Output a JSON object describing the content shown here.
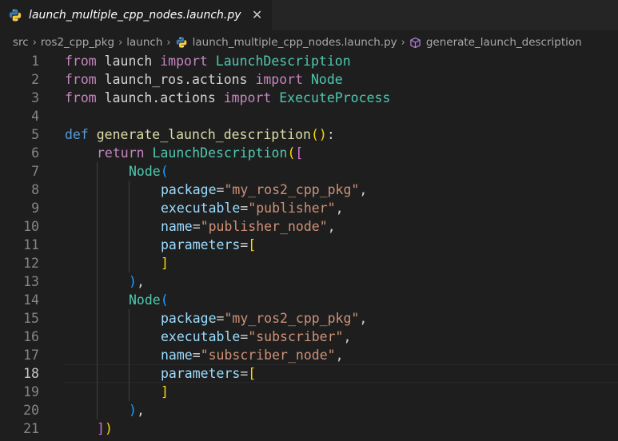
{
  "tab": {
    "label": "launch_multiple_cpp_nodes.launch.py",
    "close_glyph": "✕"
  },
  "breadcrumb": [
    {
      "label": "src",
      "icon": ""
    },
    {
      "label": "ros2_cpp_pkg",
      "icon": ""
    },
    {
      "label": "launch",
      "icon": ""
    },
    {
      "label": "launch_multiple_cpp_nodes.launch.py",
      "icon": "python-icon"
    },
    {
      "label": "generate_launch_description",
      "icon": "cube-icon"
    }
  ],
  "editor": {
    "current_line": 18,
    "colors": {
      "keyword_control": "#c586c0",
      "keyword": "#569cd6",
      "function": "#dcdcaa",
      "class": "#4ec9b0",
      "string": "#ce9178",
      "parameter": "#9cdcfe"
    },
    "lines": [
      {
        "n": "1",
        "indent": 0,
        "t": [
          [
            "from",
            "kw"
          ],
          [
            " launch ",
            "pl"
          ],
          [
            "import",
            "kw"
          ],
          [
            " ",
            "pl"
          ],
          [
            "LaunchDescription",
            "cls"
          ]
        ]
      },
      {
        "n": "2",
        "indent": 0,
        "t": [
          [
            "from",
            "kw"
          ],
          [
            " launch_ros.actions ",
            "pl"
          ],
          [
            "import",
            "kw"
          ],
          [
            " ",
            "pl"
          ],
          [
            "Node",
            "cls"
          ]
        ]
      },
      {
        "n": "3",
        "indent": 0,
        "t": [
          [
            "from",
            "kw"
          ],
          [
            " launch.actions ",
            "pl"
          ],
          [
            "import",
            "kw"
          ],
          [
            " ",
            "pl"
          ],
          [
            "ExecuteProcess",
            "cls"
          ]
        ]
      },
      {
        "n": "4",
        "indent": 0,
        "t": []
      },
      {
        "n": "5",
        "indent": 0,
        "t": [
          [
            "def",
            "kwb"
          ],
          [
            " ",
            "pl"
          ],
          [
            "generate_launch_description",
            "fn"
          ],
          [
            "()",
            "b1"
          ],
          [
            ":",
            "pl"
          ]
        ]
      },
      {
        "n": "6",
        "indent": 1,
        "t": [
          [
            "return",
            "kw"
          ],
          [
            " ",
            "pl"
          ],
          [
            "LaunchDescription",
            "cls"
          ],
          [
            "(",
            "b1"
          ],
          [
            "[",
            "b2"
          ]
        ]
      },
      {
        "n": "7",
        "indent": 2,
        "t": [
          [
            "Node",
            "cls"
          ],
          [
            "(",
            "b3"
          ]
        ]
      },
      {
        "n": "8",
        "indent": 3,
        "t": [
          [
            "package",
            "par"
          ],
          [
            "=",
            "pl"
          ],
          [
            "\"my_ros2_cpp_pkg\"",
            "str"
          ],
          [
            ",",
            "pl"
          ]
        ]
      },
      {
        "n": "9",
        "indent": 3,
        "t": [
          [
            "executable",
            "par"
          ],
          [
            "=",
            "pl"
          ],
          [
            "\"publisher\"",
            "str"
          ],
          [
            ",",
            "pl"
          ]
        ]
      },
      {
        "n": "10",
        "indent": 3,
        "t": [
          [
            "name",
            "par"
          ],
          [
            "=",
            "pl"
          ],
          [
            "\"publisher_node\"",
            "str"
          ],
          [
            ",",
            "pl"
          ]
        ]
      },
      {
        "n": "11",
        "indent": 3,
        "t": [
          [
            "parameters",
            "par"
          ],
          [
            "=",
            "pl"
          ],
          [
            "[",
            "b1"
          ]
        ]
      },
      {
        "n": "12",
        "indent": 3,
        "t": [
          [
            "]",
            "b1"
          ]
        ]
      },
      {
        "n": "13",
        "indent": 2,
        "t": [
          [
            ")",
            "b3"
          ],
          [
            ",",
            "pl"
          ]
        ]
      },
      {
        "n": "14",
        "indent": 2,
        "t": [
          [
            "Node",
            "cls"
          ],
          [
            "(",
            "b3"
          ]
        ]
      },
      {
        "n": "15",
        "indent": 3,
        "t": [
          [
            "package",
            "par"
          ],
          [
            "=",
            "pl"
          ],
          [
            "\"my_ros2_cpp_pkg\"",
            "str"
          ],
          [
            ",",
            "pl"
          ]
        ]
      },
      {
        "n": "16",
        "indent": 3,
        "t": [
          [
            "executable",
            "par"
          ],
          [
            "=",
            "pl"
          ],
          [
            "\"subscriber\"",
            "str"
          ],
          [
            ",",
            "pl"
          ]
        ]
      },
      {
        "n": "17",
        "indent": 3,
        "t": [
          [
            "name",
            "par"
          ],
          [
            "=",
            "pl"
          ],
          [
            "\"subscriber_node\"",
            "str"
          ],
          [
            ",",
            "pl"
          ]
        ]
      },
      {
        "n": "18",
        "indent": 3,
        "t": [
          [
            "parameters",
            "par"
          ],
          [
            "=",
            "pl"
          ],
          [
            "[",
            "b1"
          ]
        ]
      },
      {
        "n": "19",
        "indent": 3,
        "t": [
          [
            "]",
            "b1"
          ]
        ]
      },
      {
        "n": "20",
        "indent": 2,
        "t": [
          [
            ")",
            "b3"
          ],
          [
            ",",
            "pl"
          ]
        ]
      },
      {
        "n": "21",
        "indent": 1,
        "t": [
          [
            "]",
            "b2"
          ],
          [
            ")",
            "b1"
          ]
        ]
      }
    ]
  }
}
